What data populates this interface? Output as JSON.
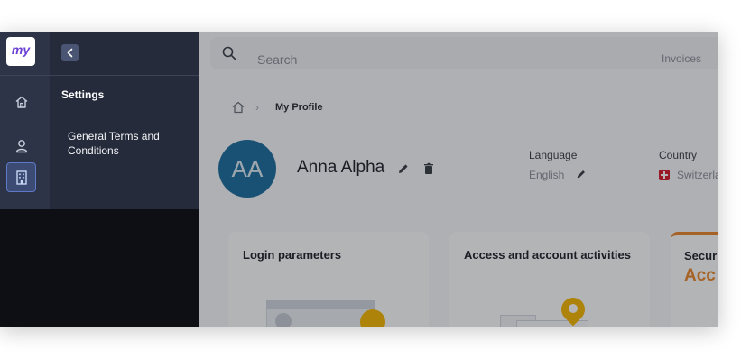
{
  "topbar": {
    "search_placeholder": "Search",
    "invoices_label": "Invoices"
  },
  "breadcrumb": {
    "current": "My Profile"
  },
  "profile": {
    "initials": "AA",
    "name": "Anna Alpha",
    "language_label": "Language",
    "language_value": "English",
    "country_label": "Country",
    "country_value": "Switzerla"
  },
  "cards": [
    {
      "title": "Login parameters"
    },
    {
      "title": "Access and account activities"
    },
    {
      "title": "Secur",
      "accent": "Acc"
    }
  ],
  "sidebar": {
    "logo_text": "my",
    "collapse_icon": "chevron-left-icon",
    "rail_icons": [
      "home-icon",
      "user-icon",
      "building-icon"
    ]
  },
  "panel": {
    "title": "Settings",
    "items": [
      {
        "label": "General Terms and Conditions"
      }
    ]
  },
  "colors": {
    "accent": "#e8892d",
    "avatar": "#1f6f9e",
    "rail": "#2d3447",
    "panel": "#252b3a",
    "active_icon": "#5d79c7"
  }
}
